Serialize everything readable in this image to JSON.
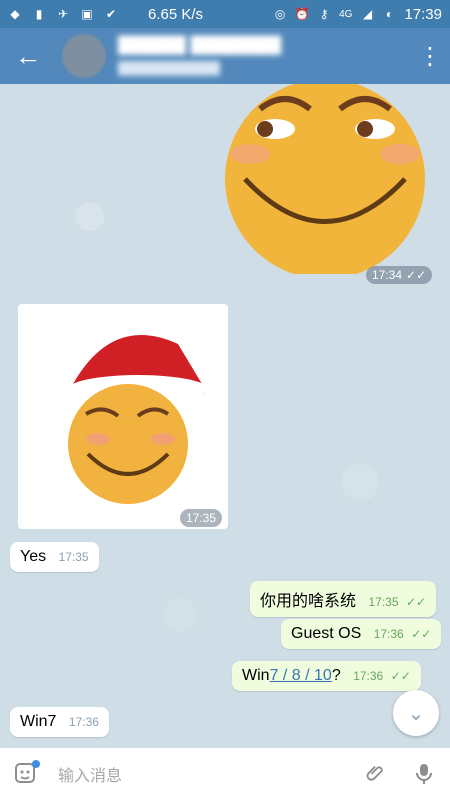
{
  "status_bar": {
    "speed": "6.65 K/s",
    "network": "4G",
    "time": "17:39"
  },
  "header": {
    "back_icon": "arrow-left-icon",
    "more_icon": "more-vertical-icon"
  },
  "messages": [
    {
      "type": "sticker",
      "direction": "out",
      "time": "17:34"
    },
    {
      "type": "photo",
      "direction": "in",
      "time": "17:35"
    },
    {
      "type": "text",
      "direction": "in",
      "text": "Yes",
      "time": "17:35"
    },
    {
      "type": "text",
      "direction": "out",
      "text": "你用的啥系统",
      "time": "17:35"
    },
    {
      "type": "text",
      "direction": "out",
      "text": "Guest OS",
      "time": "17:36"
    },
    {
      "type": "text",
      "direction": "out",
      "text_prefix": "Win",
      "text_link": "7 / 8 / 10",
      "text_suffix": "?",
      "time": "17:36"
    },
    {
      "type": "text",
      "direction": "in",
      "text": "Win7",
      "time": "17:36"
    }
  ],
  "composer": {
    "placeholder": "输入消息"
  }
}
